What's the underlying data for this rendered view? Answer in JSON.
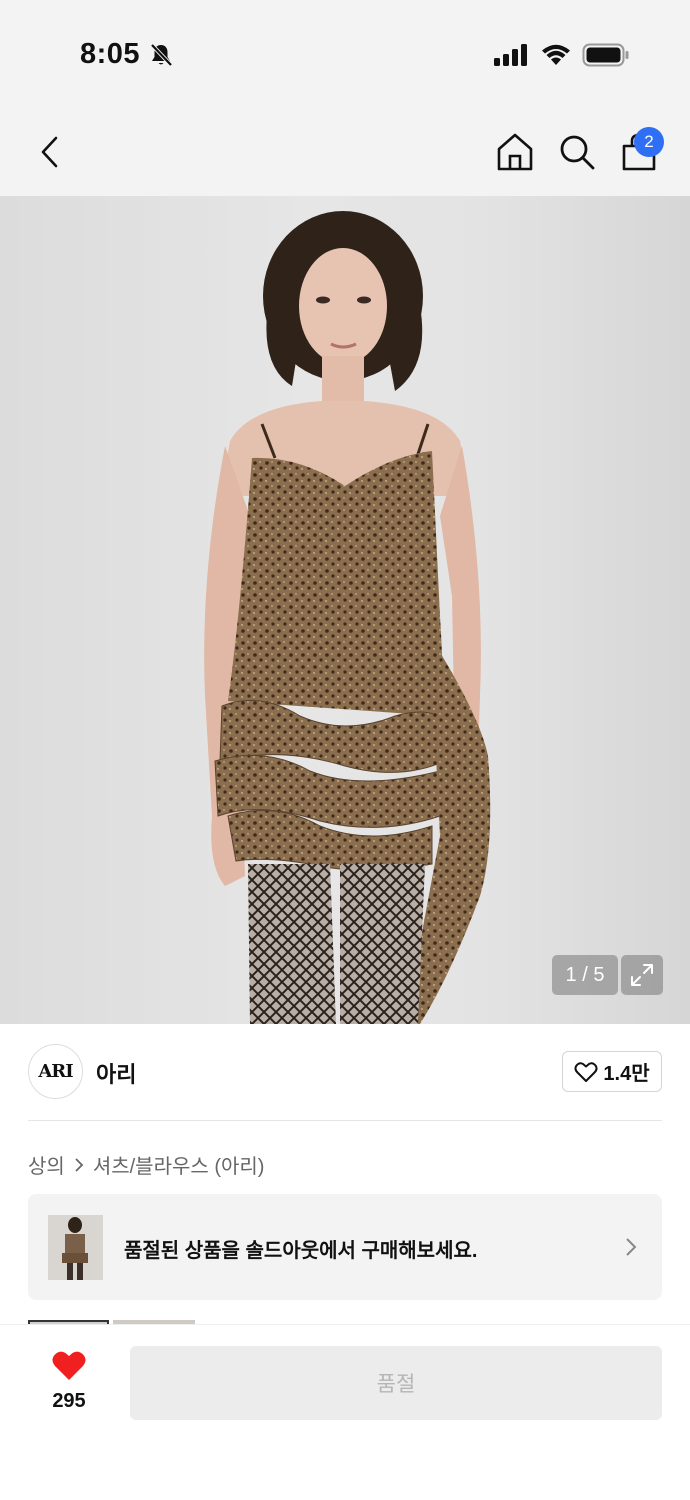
{
  "status_bar": {
    "time": "8:05",
    "icons": [
      "bell-slash-icon",
      "signal-icon",
      "wifi-icon",
      "battery-icon"
    ]
  },
  "nav": {
    "icons": [
      "back-chevron-icon",
      "home-icon",
      "search-icon",
      "shopping-bag-icon"
    ],
    "cart_count": "2",
    "badge_color": "#2f6ff3"
  },
  "gallery": {
    "counter": "1 / 5",
    "expand_icon": "expand-icon"
  },
  "brand": {
    "logo_text": "ARI",
    "name": "아리",
    "likes": "1.4만"
  },
  "breadcrumb": {
    "category": "상의",
    "subcategory": "셔츠/블라우스 (아리)"
  },
  "soldout_banner": {
    "text": "품절된 상품을 솔드아웃에서 구매해보세요."
  },
  "bottom_bar": {
    "wish_count": "295",
    "heart_color": "#f02020",
    "buy_label": "품절"
  }
}
